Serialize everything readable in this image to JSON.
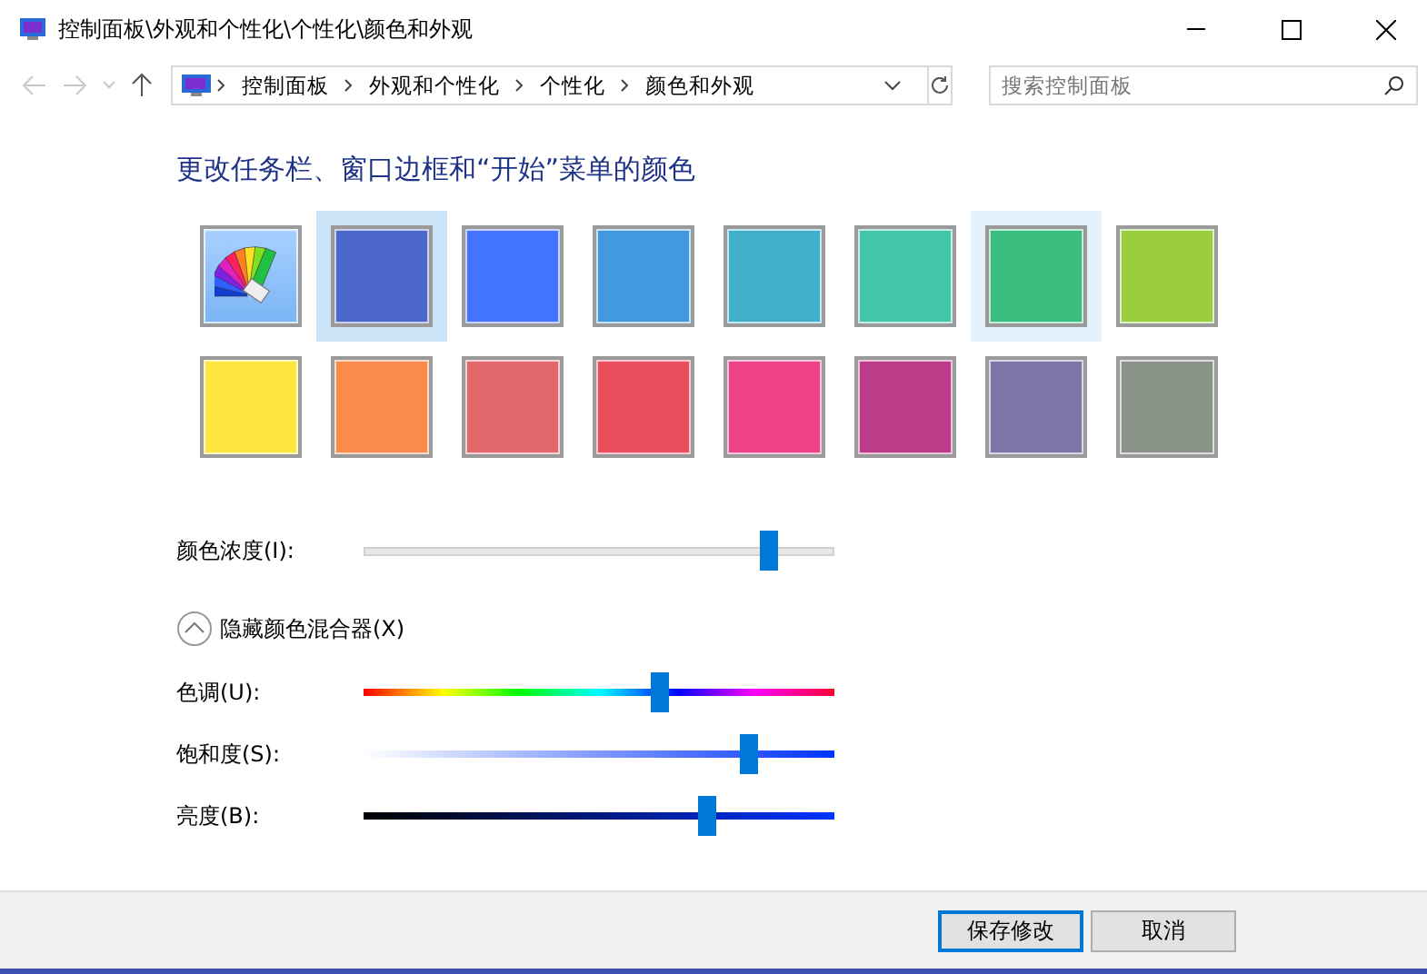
{
  "window": {
    "title": "控制面板\\外观和个性化\\个性化\\颜色和外观"
  },
  "address_bar": {
    "breadcrumbs": [
      "控制面板",
      "外观和个性化",
      "个性化",
      "颜色和外观"
    ]
  },
  "search": {
    "placeholder": "搜索控制面板"
  },
  "heading": "更改任务栏、窗口边框和“开始”菜单的颜色",
  "swatches": [
    {
      "kind": "custom",
      "selected": false,
      "hovered": false
    },
    {
      "kind": "color",
      "color": "#4a67c9",
      "selected": true,
      "hovered": false
    },
    {
      "kind": "color",
      "color": "#4374ff",
      "selected": false,
      "hovered": false
    },
    {
      "kind": "color",
      "color": "#4399e0",
      "selected": false,
      "hovered": false
    },
    {
      "kind": "color",
      "color": "#43b0cb",
      "selected": false,
      "hovered": false
    },
    {
      "kind": "color",
      "color": "#42c6ac",
      "selected": false,
      "hovered": false
    },
    {
      "kind": "color",
      "color": "#3bbf7f",
      "selected": false,
      "hovered": true
    },
    {
      "kind": "color",
      "color": "#9ccc40",
      "selected": false,
      "hovered": false
    },
    {
      "kind": "color",
      "color": "#fde640",
      "selected": false,
      "hovered": false
    },
    {
      "kind": "color",
      "color": "#fa8b4a",
      "selected": false,
      "hovered": false
    },
    {
      "kind": "color",
      "color": "#e2686c",
      "selected": false,
      "hovered": false
    },
    {
      "kind": "color",
      "color": "#ea4d5c",
      "selected": false,
      "hovered": false
    },
    {
      "kind": "color",
      "color": "#ef4186",
      "selected": false,
      "hovered": false
    },
    {
      "kind": "color",
      "color": "#bd3c8a",
      "selected": false,
      "hovered": false
    },
    {
      "kind": "color",
      "color": "#7e74a6",
      "selected": false,
      "hovered": false
    },
    {
      "kind": "color",
      "color": "#889286",
      "selected": false,
      "hovered": false
    }
  ],
  "intensity": {
    "label": "颜色浓度(I):",
    "kind": "plain",
    "level": 0.86
  },
  "mixer_toggle": {
    "label": "隐藏颜色混合器(X)",
    "expanded": true
  },
  "mixer": [
    {
      "label": "色调(U):",
      "kind": "hue",
      "level": 0.63
    },
    {
      "label": "饱和度(S):",
      "kind": "saturation",
      "level": 0.82
    },
    {
      "label": "亮度(B):",
      "kind": "brightness",
      "level": 0.73
    }
  ],
  "buttons": [
    {
      "label": "保存修改",
      "focused": true
    },
    {
      "label": "取消",
      "focused": false
    }
  ]
}
